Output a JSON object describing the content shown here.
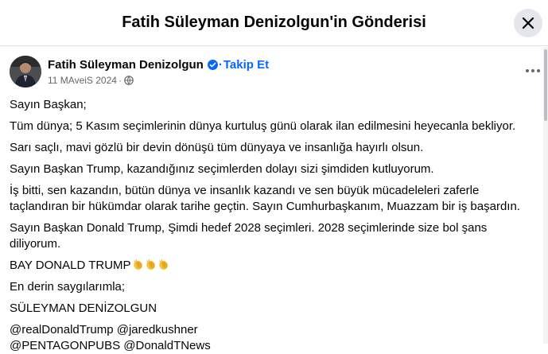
{
  "dialog": {
    "title": "Fatih Süleyman Denizolgun'in Gönderisi"
  },
  "post": {
    "author": "Fatih Süleyman Denizolgun",
    "follow_label": "Takip Et",
    "separator": "·",
    "date": "11 MAveiS 2024",
    "date_suffix": "·",
    "paragraphs": [
      "Sayın Başkan;",
      "Tüm dünya; 5 Kasım seçimlerinin dünya kurtuluş günü olarak ilan edilmesini heyecanla bekliyor.",
      "Sarı saçlı, mavi gözlü bir devin dönüşü tüm dünyaya ve insanlığa hayırlı olsun.",
      "Sayın Başkan Trump, kazandığınız seçimlerden dolayı sizi şimdiden kutluyorum.",
      "İş bitti, sen kazandın, bütün dünya ve insanlık kazandı ve sen büyük mücadeleleri zaferle taçlandıran bir hükümdar olarak tarihe geçtin. Sayın Cumhurbaşkanım, Muazzam bir iş başardın.",
      "Sayın Başkan Donald Trump, Şimdi hedef 2028 seçimleri. 2028 seçimlerinde size bol şans diliyorum.",
      "BAY DONALD TRUMP",
      "En derin saygılarımla;",
      "SÜLEYMAN DENİZOLGUN"
    ],
    "mentions_line1": "@realDonaldTrump @jaredkushner",
    "mentions_line2": "@PENTAGONPUBS @DonaldTNews"
  },
  "icons": {
    "close": "close-icon",
    "verified": "verified-badge-icon",
    "globe": "globe-icon",
    "more": "more-options-icon",
    "clap": "clapping-hands-emoji"
  },
  "colors": {
    "accent": "#0866ff",
    "secondary_text": "#65676b",
    "button_bg": "#e4e6eb"
  }
}
